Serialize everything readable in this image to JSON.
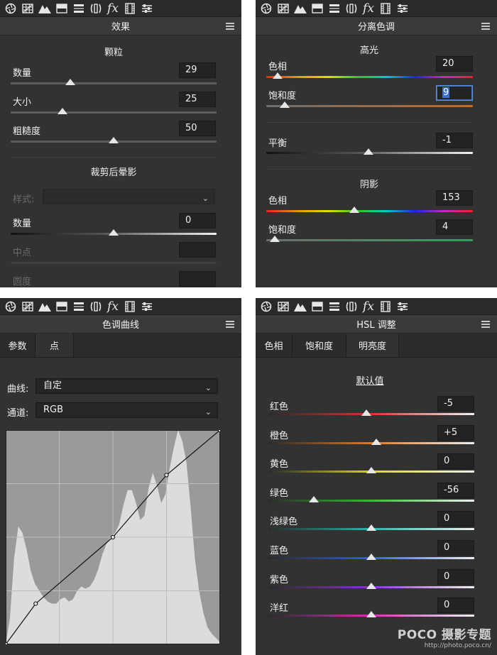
{
  "colors": {
    "panel_bg": "#323232",
    "toolbar_bg": "#2a2a2a",
    "field_bg": "#232323",
    "focus_border": "#5b8fd8",
    "text": "#f0f0f0",
    "disabled_text": "#6a6a6a"
  },
  "toolbar_icons": [
    "aperture-icon",
    "grid-icon",
    "mountains-icon",
    "split-tone-icon",
    "divider-lines-icon",
    "lens-bracket-icon",
    "fx-icon",
    "film-strip-icon",
    "sliders-icon"
  ],
  "toolbar_fx_label": "fx",
  "effects": {
    "title": "效果",
    "grain": {
      "heading": "颗粒",
      "amount": {
        "label": "数量",
        "value": "29",
        "pos": 0.29
      },
      "size": {
        "label": "大小",
        "value": "25",
        "pos": 0.25
      },
      "roughness": {
        "label": "粗糙度",
        "value": "50",
        "pos": 0.5
      }
    },
    "vignette": {
      "heading": "裁剪后晕影",
      "style_label": "样式:",
      "style_value": "",
      "amount": {
        "label": "数量",
        "value": "0",
        "pos": 0.5
      },
      "midpoint": {
        "label": "中点",
        "value": ""
      },
      "roundness": {
        "label": "圆度",
        "value": ""
      }
    }
  },
  "split_toning": {
    "title": "分离色调",
    "highlights": {
      "heading": "高光",
      "hue": {
        "label": "色相",
        "value": "20",
        "pos": 0.056
      },
      "saturation": {
        "label": "饱和度",
        "value": "9",
        "pos": 0.09
      }
    },
    "balance": {
      "label": "平衡",
      "value": "-1",
      "pos": 0.495
    },
    "shadows": {
      "heading": "阴影",
      "hue": {
        "label": "色相",
        "value": "153",
        "pos": 0.425
      },
      "saturation": {
        "label": "饱和度",
        "value": "4",
        "pos": 0.04
      }
    }
  },
  "tone_curve": {
    "title": "色调曲线",
    "tabs": [
      "参数",
      "点"
    ],
    "active_tab": 1,
    "curve_label": "曲线:",
    "curve_value": "自定",
    "channel_label": "通道:",
    "channel_value": "RGB",
    "points": [
      [
        0,
        0
      ],
      [
        0.14,
        0.19
      ],
      [
        0.5,
        0.5
      ],
      [
        0.75,
        0.79
      ],
      [
        1,
        1
      ]
    ],
    "histogram": [
      0.0,
      0.12,
      0.4,
      0.55,
      0.52,
      0.44,
      0.34,
      0.28,
      0.25,
      0.22,
      0.2,
      0.19,
      0.19,
      0.21,
      0.22,
      0.2,
      0.21,
      0.25,
      0.27,
      0.26,
      0.27,
      0.3,
      0.35,
      0.42,
      0.47,
      0.5,
      0.52,
      0.56,
      0.65,
      0.72,
      0.72,
      0.66,
      0.58,
      0.6,
      0.73,
      0.8,
      0.74,
      0.66,
      0.7,
      0.82,
      0.92,
      1.0,
      0.95,
      0.85,
      0.64,
      0.4,
      0.25,
      0.15,
      0.08,
      0.05,
      0.03,
      0.01
    ]
  },
  "hsl": {
    "title": "HSL 调整",
    "tabs": [
      "色相",
      "饱和度",
      "明亮度"
    ],
    "active_tab": 2,
    "defaults_label": "默认值",
    "rows": [
      {
        "label": "红色",
        "value": "-5",
        "pos": 0.475,
        "color": "#e03030"
      },
      {
        "label": "橙色",
        "value": "+5",
        "pos": 0.525,
        "color": "#e07820"
      },
      {
        "label": "黄色",
        "value": "0",
        "pos": 0.5,
        "color": "#d8d820"
      },
      {
        "label": "绿色",
        "value": "-56",
        "pos": 0.22,
        "color": "#30c030"
      },
      {
        "label": "浅绿色",
        "value": "0",
        "pos": 0.5,
        "color": "#20b8a8"
      },
      {
        "label": "蓝色",
        "value": "0",
        "pos": 0.5,
        "color": "#3060e0"
      },
      {
        "label": "紫色",
        "value": "0",
        "pos": 0.5,
        "color": "#9030d0"
      },
      {
        "label": "洋红",
        "value": "0",
        "pos": 0.5,
        "color": "#d030c0"
      }
    ]
  },
  "watermark": {
    "brand": "POCO 摄影专题",
    "url": "http://photo.poco.cn/"
  }
}
